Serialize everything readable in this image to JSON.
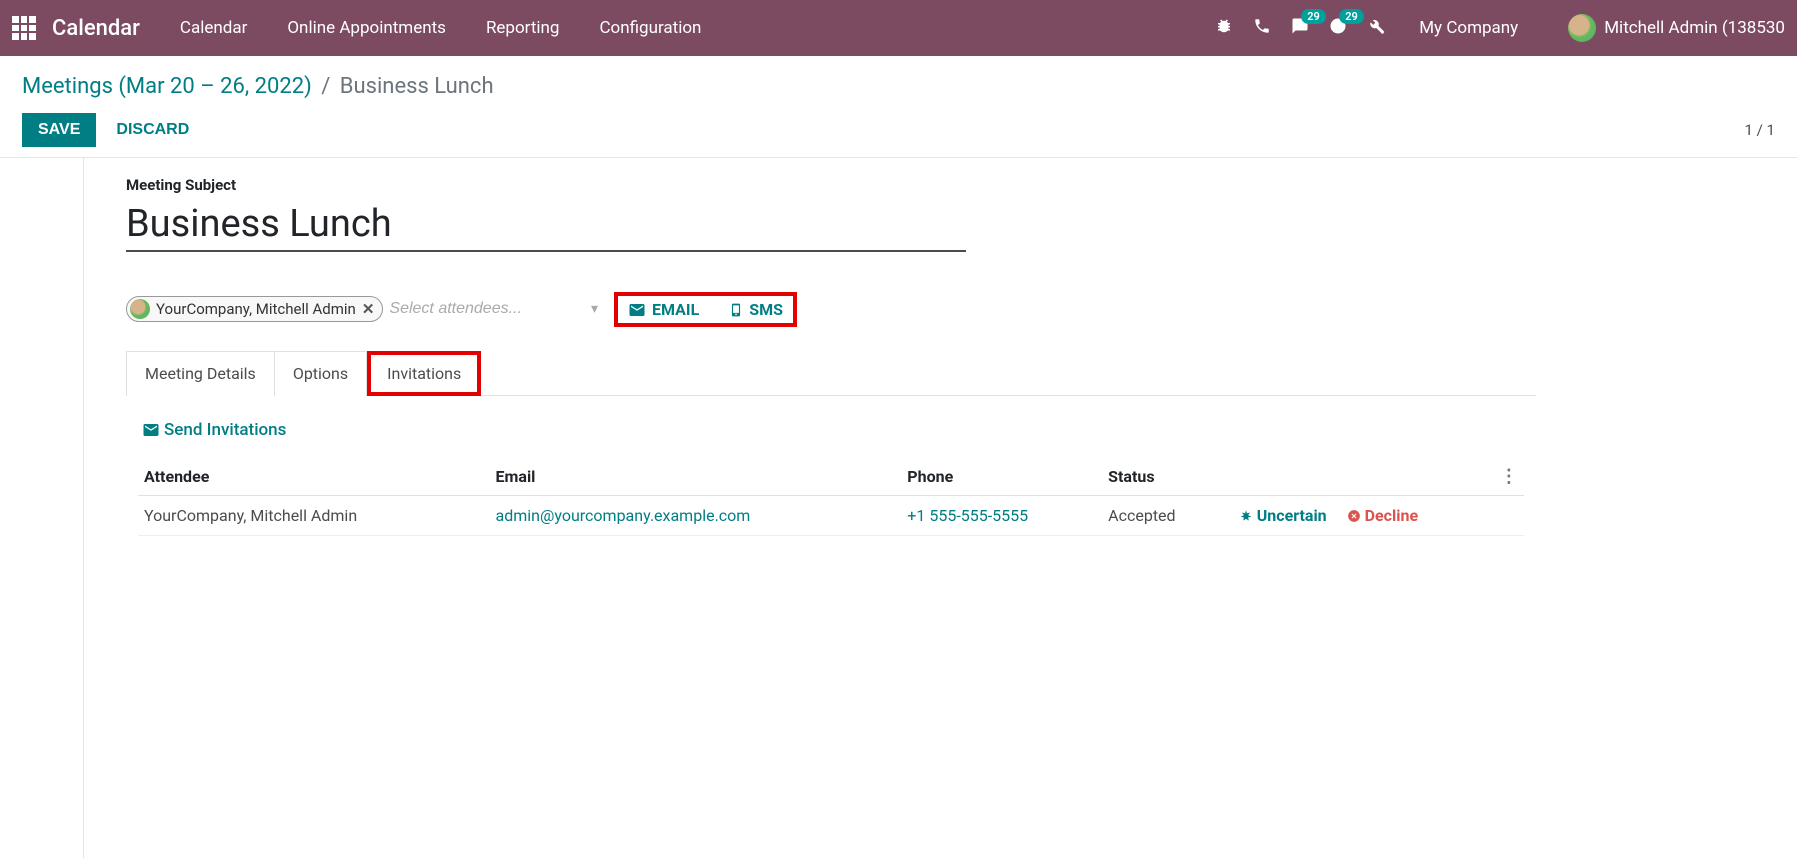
{
  "header": {
    "app_title": "Calendar",
    "nav": [
      "Calendar",
      "Online Appointments",
      "Reporting",
      "Configuration"
    ],
    "msg_count": "29",
    "activity_count": "29",
    "company": "My Company",
    "user": "Mitchell Admin (138530"
  },
  "breadcrumb": {
    "parent": "Meetings (Mar 20 – 26, 2022)",
    "current": "Business Lunch"
  },
  "buttons": {
    "save": "SAVE",
    "discard": "DISCARD"
  },
  "pager": "1 / 1",
  "form": {
    "subject_label": "Meeting Subject",
    "subject": "Business Lunch",
    "attendee_tag": "YourCompany, Mitchell Admin",
    "attendee_placeholder": "Select attendees...",
    "email_btn": "EMAIL",
    "sms_btn": "SMS"
  },
  "tabs": [
    "Meeting Details",
    "Options",
    "Invitations"
  ],
  "invitations": {
    "send": "Send Invitations",
    "headers": {
      "attendee": "Attendee",
      "email": "Email",
      "phone": "Phone",
      "status": "Status"
    },
    "row": {
      "attendee": "YourCompany, Mitchell Admin",
      "email": "admin@yourcompany.example.com",
      "phone": "+1 555-555-5555",
      "status": "Accepted",
      "uncertain": "Uncertain",
      "decline": "Decline"
    }
  }
}
